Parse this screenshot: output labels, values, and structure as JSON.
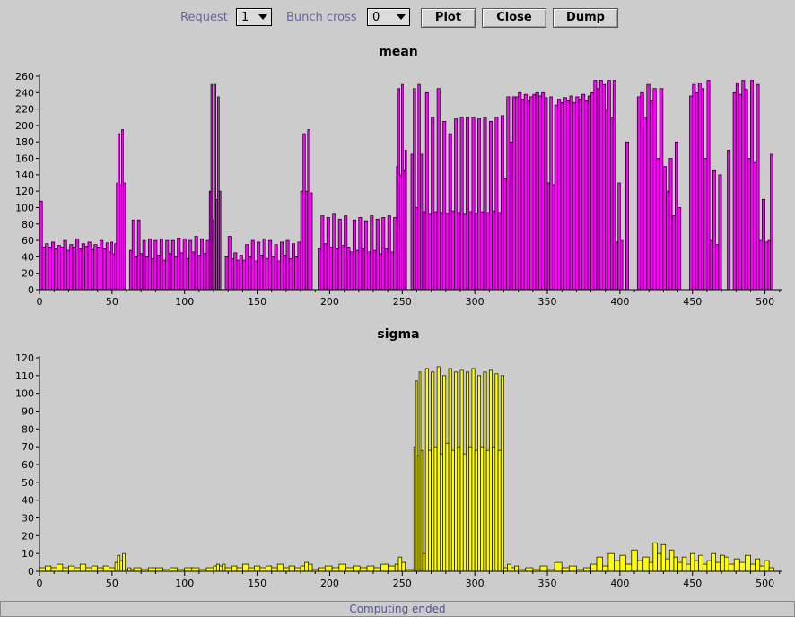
{
  "toolbar": {
    "request_label": "Request",
    "request_value": "1",
    "bunch_label": "Bunch cross",
    "bunch_value": "0",
    "plot_label": "Plot",
    "close_label": "Close",
    "dump_label": "Dump"
  },
  "status": {
    "text": "Computing ended"
  },
  "colors": {
    "mean_fill": "#ff00ff",
    "sigma_fill": "#ffff00",
    "background": "#cccccc",
    "outline": "#000000"
  },
  "chart_data": [
    {
      "type": "bar",
      "title": "mean",
      "xlabel": "",
      "ylabel": "",
      "xlim": [
        0,
        512
      ],
      "ylim": [
        0,
        260
      ],
      "xticks": [
        "0",
        "50",
        "100",
        "150",
        "200",
        "250",
        "300",
        "350",
        "400",
        "450",
        "500"
      ],
      "yticks": [
        "0",
        "20",
        "40",
        "60",
        "80",
        "100",
        "120",
        "140",
        "160",
        "180",
        "200",
        "220",
        "240",
        "260"
      ],
      "grid": false,
      "segments": [
        {
          "x": [
            0,
            2
          ],
          "values": [
            108
          ]
        },
        {
          "x": [
            2,
            48
          ],
          "values": [
            52,
            56,
            52,
            58,
            50,
            54,
            52,
            60,
            48,
            55,
            52,
            62,
            50,
            56,
            53,
            58,
            49,
            55,
            52,
            60,
            50,
            57
          ]
        },
        {
          "x": [
            48,
            53
          ],
          "values": [
            46,
            58,
            44,
            56
          ]
        },
        {
          "x": [
            53,
            59
          ],
          "values": [
            130,
            190,
            128,
            195,
            130
          ]
        },
        {
          "x": [
            59,
            62
          ],
          "values": [
            0
          ]
        },
        {
          "x": [
            62,
            73
          ],
          "values": [
            48,
            85,
            40,
            85,
            44,
            60
          ]
        },
        {
          "x": [
            73,
            109
          ],
          "values": [
            40,
            62,
            38,
            60,
            42,
            62,
            36,
            60,
            44,
            60,
            40,
            63,
            45,
            62,
            38,
            60,
            46,
            65
          ]
        },
        {
          "x": [
            109,
            117
          ],
          "values": [
            42,
            62,
            44,
            60
          ]
        },
        {
          "x": [
            117,
            125
          ],
          "values": [
            120,
            250,
            85,
            250,
            110,
            235,
            120
          ]
        },
        {
          "x": [
            125,
            128
          ],
          "values": [
            0
          ]
        },
        {
          "x": [
            128,
            140
          ],
          "values": [
            40,
            65,
            38,
            45,
            36,
            42
          ]
        },
        {
          "x": [
            140,
            180
          ],
          "values": [
            36,
            55,
            40,
            60,
            35,
            58,
            42,
            62,
            38,
            60,
            40,
            55,
            35,
            58,
            42,
            60,
            38,
            56,
            40,
            58
          ]
        },
        {
          "x": [
            180,
            188
          ],
          "values": [
            120,
            190,
            120,
            195,
            118
          ]
        },
        {
          "x": [
            188,
            192
          ],
          "values": [
            0
          ]
        },
        {
          "x": [
            192,
            214
          ],
          "values": [
            50,
            90,
            56,
            88,
            52,
            92,
            50,
            86,
            54,
            90,
            52
          ]
        },
        {
          "x": [
            214,
            246
          ],
          "values": [
            46,
            85,
            48,
            88,
            50,
            84,
            46,
            90,
            48,
            86,
            44,
            88,
            50,
            90,
            46,
            88
          ]
        },
        {
          "x": [
            246,
            253
          ],
          "values": [
            150,
            245,
            140,
            250,
            145,
            170
          ]
        },
        {
          "x": [
            253,
            256
          ],
          "values": [
            0
          ]
        },
        {
          "x": [
            256,
            264
          ],
          "values": [
            165,
            245,
            100,
            250,
            165
          ]
        },
        {
          "x": [
            264,
            296
          ],
          "values": [
            95,
            240,
            92,
            210,
            95,
            245,
            94,
            205,
            93,
            190,
            96,
            208,
            94,
            210,
            92,
            210
          ]
        },
        {
          "x": [
            296,
            320
          ],
          "values": [
            95,
            210,
            93,
            208,
            95,
            210,
            94,
            205,
            96,
            210,
            94,
            212
          ]
        },
        {
          "x": [
            320,
            350
          ],
          "values": [
            135,
            235,
            180,
            235,
            235,
            240,
            232,
            238,
            230,
            235,
            238,
            240,
            236,
            240,
            234
          ]
        },
        {
          "x": [
            350,
            355
          ],
          "values": [
            130,
            235,
            128
          ]
        },
        {
          "x": [
            355,
            380
          ],
          "values": [
            225,
            232,
            228,
            234,
            230,
            236,
            228,
            235,
            232,
            238,
            230,
            236
          ]
        },
        {
          "x": [
            380,
            390
          ],
          "values": [
            240,
            255,
            245,
            255,
            250
          ]
        },
        {
          "x": [
            390,
            397
          ],
          "values": [
            220,
            255,
            210,
            255
          ]
        },
        {
          "x": [
            397,
            402
          ],
          "values": [
            58,
            130,
            60
          ]
        },
        {
          "x": [
            402,
            408
          ],
          "values": [
            0,
            180,
            0
          ]
        },
        {
          "x": [
            408,
            412
          ],
          "values": [
            0
          ]
        },
        {
          "x": [
            412,
            425
          ],
          "values": [
            235,
            240,
            210,
            250,
            230,
            245
          ]
        },
        {
          "x": [
            425,
            432
          ],
          "values": [
            160,
            245,
            150
          ]
        },
        {
          "x": [
            432,
            442
          ],
          "values": [
            120,
            160,
            90,
            180,
            100
          ]
        },
        {
          "x": [
            442,
            448
          ],
          "values": [
            0
          ]
        },
        {
          "x": [
            448,
            458
          ],
          "values": [
            236,
            250,
            240,
            252,
            245
          ]
        },
        {
          "x": [
            458,
            462
          ],
          "values": [
            160,
            255
          ]
        },
        {
          "x": [
            462,
            470
          ],
          "values": [
            60,
            145,
            55,
            140
          ]
        },
        {
          "x": [
            470,
            478
          ],
          "values": [
            0,
            0,
            170,
            0
          ]
        },
        {
          "x": [
            478,
            488
          ],
          "values": [
            240,
            252,
            238,
            255,
            244
          ]
        },
        {
          "x": [
            488,
            496
          ],
          "values": [
            160,
            255,
            155,
            250
          ]
        },
        {
          "x": [
            496,
            502
          ],
          "values": [
            60,
            110,
            58
          ]
        },
        {
          "x": [
            502,
            507
          ],
          "values": [
            60,
            165,
            0
          ]
        }
      ]
    },
    {
      "type": "bar",
      "title": "sigma",
      "xlabel": "",
      "ylabel": "",
      "xlim": [
        0,
        512
      ],
      "ylim": [
        0,
        120
      ],
      "xticks": [
        "0",
        "50",
        "100",
        "150",
        "200",
        "250",
        "300",
        "350",
        "400",
        "450",
        "500"
      ],
      "yticks": [
        "0",
        "10",
        "20",
        "30",
        "40",
        "50",
        "60",
        "70",
        "80",
        "90",
        "100",
        "110",
        "120"
      ],
      "grid": false,
      "segments": [
        {
          "x": [
            0,
            52
          ],
          "values": [
            2,
            3,
            2,
            4,
            2,
            3,
            2,
            4,
            2,
            3,
            2,
            3,
            2
          ]
        },
        {
          "x": [
            52,
            59
          ],
          "values": [
            5,
            9,
            6,
            10
          ]
        },
        {
          "x": [
            59,
            65
          ],
          "values": [
            1,
            2,
            1
          ]
        },
        {
          "x": [
            65,
            120
          ],
          "values": [
            2,
            1,
            2,
            2,
            1,
            2,
            1,
            2,
            2,
            1,
            2
          ]
        },
        {
          "x": [
            120,
            128
          ],
          "values": [
            3,
            4,
            3,
            4
          ]
        },
        {
          "x": [
            128,
            180
          ],
          "values": [
            2,
            3,
            2,
            4,
            2,
            3,
            2,
            3,
            2,
            4,
            2,
            3,
            2
          ]
        },
        {
          "x": [
            180,
            188
          ],
          "values": [
            3,
            5,
            4
          ]
        },
        {
          "x": [
            188,
            192
          ],
          "values": [
            1
          ]
        },
        {
          "x": [
            192,
            245
          ],
          "values": [
            2,
            3,
            2,
            4,
            2,
            3,
            2,
            3,
            2,
            4,
            3
          ]
        },
        {
          "x": [
            245,
            252
          ],
          "values": [
            4,
            8,
            5
          ]
        },
        {
          "x": [
            252,
            258
          ],
          "values": [
            1
          ]
        },
        {
          "x": [
            258,
            264
          ],
          "values": [
            70,
            107,
            65,
            112,
            68
          ]
        },
        {
          "x": [
            264,
            320
          ],
          "values": [
            10,
            114,
            68,
            112,
            70,
            115,
            66,
            110,
            72,
            114,
            68,
            112,
            70,
            113,
            66,
            112,
            70,
            114,
            68,
            110,
            70,
            112,
            68,
            113,
            70,
            111,
            68,
            110
          ]
        },
        {
          "x": [
            320,
            330
          ],
          "values": [
            2,
            4,
            2,
            3
          ]
        },
        {
          "x": [
            330,
            380
          ],
          "values": [
            1,
            2,
            1,
            3,
            1,
            5,
            2,
            3,
            1,
            2
          ]
        },
        {
          "x": [
            380,
            420
          ],
          "values": [
            4,
            8,
            3,
            10,
            6,
            9,
            4,
            12,
            6,
            8
          ]
        },
        {
          "x": [
            420,
            440
          ],
          "values": [
            5,
            16,
            10,
            15,
            7,
            12,
            8
          ]
        },
        {
          "x": [
            440,
            460
          ],
          "values": [
            5,
            8,
            4,
            10,
            6,
            9,
            4
          ]
        },
        {
          "x": [
            460,
            475
          ],
          "values": [
            6,
            10,
            5,
            9,
            8
          ]
        },
        {
          "x": [
            475,
            490
          ],
          "values": [
            4,
            7,
            5,
            9
          ]
        },
        {
          "x": [
            490,
            506
          ],
          "values": [
            4,
            7,
            3,
            6,
            2
          ]
        }
      ]
    }
  ]
}
